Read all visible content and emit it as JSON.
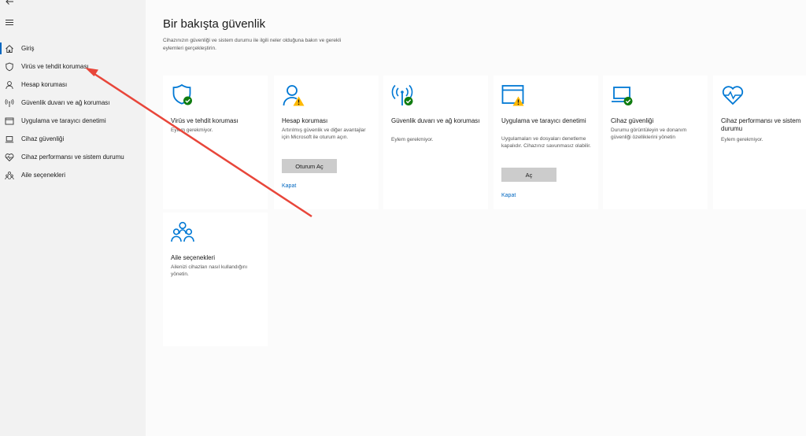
{
  "sidebar": {
    "back_icon": "back-arrow-icon",
    "menu_icon": "hamburger-icon",
    "items": [
      {
        "label": "Giriş",
        "icon": "home-icon"
      },
      {
        "label": "Virüs ve tehdit koruması",
        "icon": "shield-icon"
      },
      {
        "label": "Hesap koruması",
        "icon": "person-icon"
      },
      {
        "label": "Güvenlik duvarı ve ağ koruması",
        "icon": "wifi-antenna-icon"
      },
      {
        "label": "Uygulama ve tarayıcı denetimi",
        "icon": "browser-window-icon"
      },
      {
        "label": "Cihaz güvenliği",
        "icon": "laptop-icon"
      },
      {
        "label": "Cihaz performansı ve sistem durumu",
        "icon": "heart-icon"
      },
      {
        "label": "Aile seçenekleri",
        "icon": "family-icon"
      }
    ],
    "active_index": 0
  },
  "main": {
    "title": "Bir bakışta güvenlik",
    "subtitle": "Cihazınızın güvenliği ve sistem durumu ile ilgili neler olduğuna bakın ve gerekli eylemleri gerçekleştirin.",
    "cards": [
      {
        "title": "Virüs ve tehdit koruması",
        "desc": "Eylem gerekmiyor.",
        "icon": "shield-check-icon",
        "status": "ok"
      },
      {
        "title": "Hesap koruması",
        "desc": "Artırılmış güvenlik ve diğer avantajlar için Microsoft ile oturum açın.",
        "icon": "person-warning-icon",
        "status": "warning",
        "button": "Oturum Aç",
        "link": "Kapat"
      },
      {
        "title": "Güvenlik duvarı ve ağ koruması",
        "desc": "Eylem gerekmiyor.",
        "icon": "antenna-check-icon",
        "status": "ok"
      },
      {
        "title": "Uygulama ve tarayıcı denetimi",
        "desc": "Uygulamaları ve dosyaları denetleme kapalıdır. Cihazınız savunmasız olabilir.",
        "icon": "browser-warning-icon",
        "status": "warning",
        "button": "Aç",
        "link": "Kapat"
      },
      {
        "title": "Cihaz güvenliği",
        "desc": "Durumu görüntüleyin ve donanım güvenliği özelliklerini yönetin",
        "icon": "laptop-check-icon",
        "status": "ok"
      },
      {
        "title": "Cihaz performansı ve sistem durumu",
        "desc": "Eylem gerekmiyor.",
        "icon": "heart-pulse-icon",
        "status": "ok"
      },
      {
        "title": "Aile seçenekleri",
        "desc": "Ailenizi cihazları nasıl kullandığını yönetin.",
        "icon": "family-icon",
        "status": "info"
      }
    ]
  },
  "colors": {
    "accent": "#0067c0",
    "icon_blue": "#0078d4",
    "ok_green": "#107c10",
    "warning_yellow": "#ffb900",
    "annotation_red": "#e8463a",
    "sidebar_bg": "#f2f2f2",
    "main_bg": "#fbfbfb",
    "button_bg": "#cccccc"
  }
}
